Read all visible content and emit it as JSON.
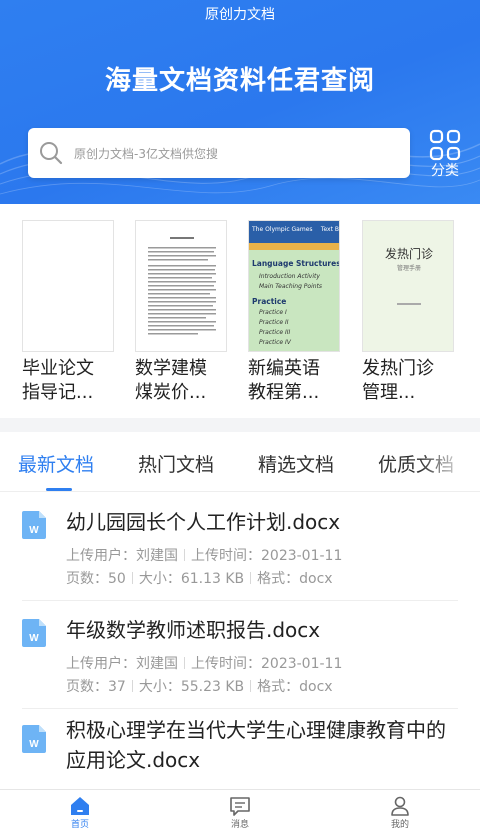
{
  "header": {
    "app_title": "原创力文档",
    "slogan": "海量文档资料任君查阅",
    "search_placeholder": "原创力文档-3亿文档供您搜",
    "category_label": "分类"
  },
  "featured_docs": [
    {
      "title_line1": "毕业论文",
      "title_line2": "指导记..."
    },
    {
      "title_line1": "数学建模",
      "title_line2": "煤炭价..."
    },
    {
      "title_line1": "新编英语",
      "title_line2": "教程第..."
    },
    {
      "title_line1": "发热门诊",
      "title_line2": "管理..."
    }
  ],
  "thumb_english": {
    "banner": "The Olympic Games",
    "banner_right": "Text B",
    "heading1": "Language Structures",
    "line1": "Introduction Activity",
    "line2": "Main Teaching Points",
    "heading2": "Practice",
    "practices": [
      "Practice I",
      "Practice II",
      "Practice III",
      "Practice IV"
    ]
  },
  "thumb_fever": {
    "title": "发热门诊",
    "subtitle": "管理手册"
  },
  "tabs": [
    "最新文档",
    "热门文档",
    "精选文档",
    "优质文档"
  ],
  "documents": [
    {
      "title": "幼儿园园长个人工作计划.docx",
      "uploader_label": "上传用户：",
      "uploader": "刘建国",
      "time_label": "上传时间：",
      "time": "2023-01-11",
      "pages_label": "页数：",
      "pages": "50",
      "size_label": "大小：",
      "size": "61.13 KB",
      "format_label": "格式：",
      "format": "docx"
    },
    {
      "title": "年级数学教师述职报告.docx",
      "uploader_label": "上传用户：",
      "uploader": "刘建国",
      "time_label": "上传时间：",
      "time": "2023-01-11",
      "pages_label": "页数：",
      "pages": "37",
      "size_label": "大小：",
      "size": "55.23 KB",
      "format_label": "格式：",
      "format": "docx"
    },
    {
      "title": "积极心理学在当代大学生心理健康教育中的应用论文.docx"
    }
  ],
  "bottom_nav": [
    {
      "label": "首页",
      "icon": "home-icon",
      "active": true
    },
    {
      "label": "消息",
      "icon": "message-icon",
      "active": false
    },
    {
      "label": "我的",
      "icon": "profile-icon",
      "active": false
    }
  ],
  "colors": {
    "primary": "#2f7ff0",
    "word_icon": "#5aaaf0"
  }
}
